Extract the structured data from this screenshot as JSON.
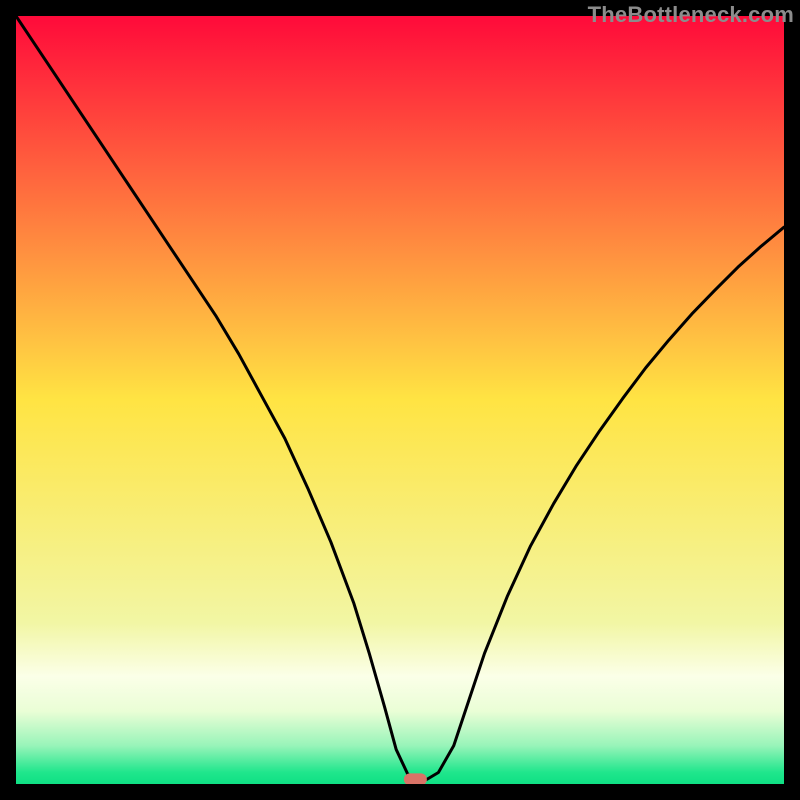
{
  "watermark": "TheBottleneck.com",
  "colors": {
    "red": "#ff0a3a",
    "yellow": "#ffe443",
    "khaki": "#f2f6a4",
    "cream": "#fbffe8",
    "yg": "#eafed6",
    "ming": "#98f4b9",
    "green": "#1fe68c",
    "green2": "#0fe084",
    "marker": "#d97367",
    "curve": "#000000"
  },
  "chart_data": {
    "type": "line",
    "title": "",
    "xlabel": "",
    "ylabel": "",
    "xlim": [
      0,
      100
    ],
    "ylim": [
      0,
      100
    ],
    "x": [
      0,
      2,
      5,
      8,
      11,
      14,
      17,
      20,
      23,
      26,
      29,
      32,
      35,
      38,
      41,
      44,
      46,
      48,
      49.5,
      51,
      52,
      53.5,
      55,
      57,
      59,
      61,
      64,
      67,
      70,
      73,
      76,
      79,
      82,
      85,
      88,
      91,
      94,
      97,
      100
    ],
    "y": [
      100,
      97,
      92.5,
      88,
      83.5,
      79,
      74.5,
      70,
      65.5,
      61,
      56,
      50.5,
      45,
      38.5,
      31.5,
      23.5,
      17,
      10,
      4.5,
      1.3,
      0.6,
      0.6,
      1.5,
      5,
      11,
      17,
      24.5,
      31,
      36.5,
      41.5,
      46,
      50.2,
      54.2,
      57.8,
      61.2,
      64.3,
      67.3,
      70,
      72.5
    ],
    "minimum_marker": {
      "x_start": 50.5,
      "x_end": 53.5,
      "y": 0.6
    }
  }
}
